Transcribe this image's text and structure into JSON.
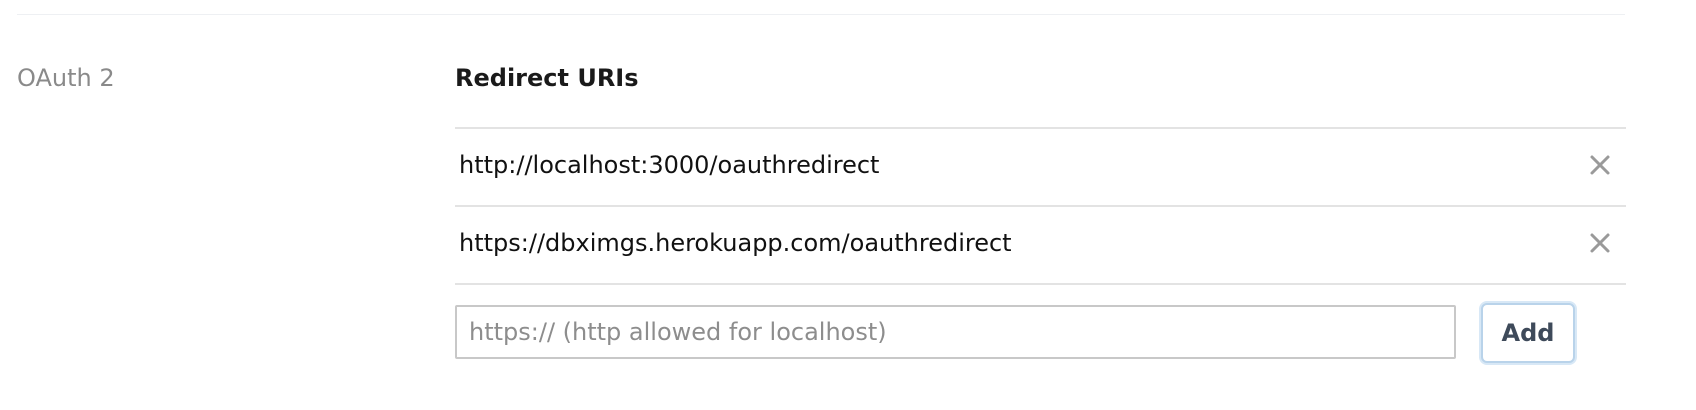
{
  "section": {
    "label": "OAuth 2"
  },
  "redirect_uris": {
    "heading": "Redirect URIs",
    "items": [
      {
        "uri": "http://localhost:3000/oauthredirect"
      },
      {
        "uri": "https://dbximgs.herokuapp.com/oauthredirect"
      }
    ],
    "remove_icon": "close-x-icon",
    "input": {
      "value": "",
      "placeholder": "https:// (http allowed for localhost)"
    },
    "add_label": "Add"
  },
  "colors": {
    "label_gray": "#8a8a8a",
    "divider": "#e3e3e3",
    "add_button_focus": "#b9d3ea",
    "add_button_text": "#3e4a5a",
    "remove_icon": "#9a9a9a"
  }
}
